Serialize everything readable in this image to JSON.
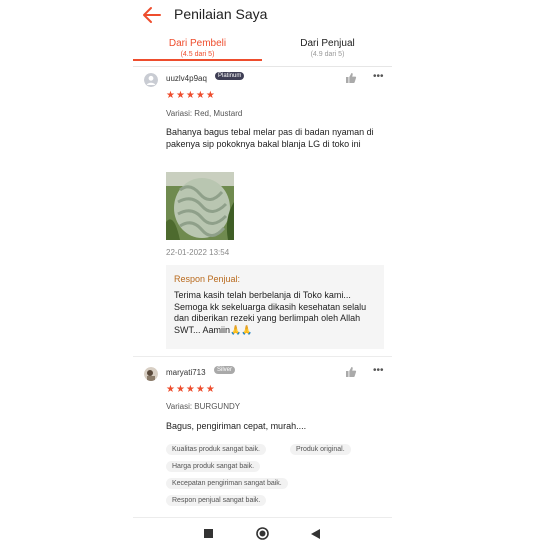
{
  "header": {
    "title": "Penilaian Saya"
  },
  "tabs": [
    {
      "label": "Dari Pembeli",
      "sub": "(4.5 dari 5)"
    },
    {
      "label": "Dari Penjual",
      "sub": "(4.9 dari 5)"
    }
  ],
  "colors": {
    "accent": "#ee4d2d",
    "platinum": "#3f3f55",
    "silver": "#a9a9a9",
    "seller_title": "#b96a1d"
  },
  "reviews": [
    {
      "username": "uuzlv4p9aq",
      "badge": "Platinum",
      "stars": "★★★★★",
      "rating": 5,
      "variant": "Variasi: Red, Mustard",
      "text": "Bahanya bagus tebal melar pas di badan nyaman di pakenya sip pokoknya bakal blanja LG di toko ini",
      "date": "22-01-2022 13:54",
      "seller_reply_title": "Respon Penjual:",
      "seller_reply": "Terima kasih telah berbelanja di Toko kami... Semoga kk sekeluarga dikasih kesehatan selalu dan diberikan rezeki yang berlimpah oleh Allah SWT... Aamiin🙏🙏"
    },
    {
      "username": "maryati713",
      "badge": "Silver",
      "stars": "★★★★★",
      "rating": 5,
      "variant": "Variasi: BURGUNDY",
      "text": "Bagus, pengiriman cepat, murah....",
      "tags": [
        "Kualitas produk sangat baik.",
        "Produk original.",
        "Harga produk sangat baik.",
        "Kecepatan pengiriman sangat baik.",
        "Respon penjual sangat baik."
      ]
    }
  ],
  "icons": {
    "back": "arrow-left-icon",
    "like": "thumbs-up-icon",
    "more": "more-dots-icon"
  },
  "navbar": [
    "square-icon",
    "circle-home-icon",
    "triangle-back-icon"
  ]
}
